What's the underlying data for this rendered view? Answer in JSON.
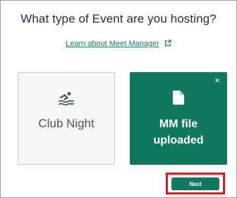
{
  "dialog": {
    "title": "What type of Event are you hosting?",
    "learn_link": "Learn about Meet Manager",
    "link_icon": "external-link-icon"
  },
  "cards": {
    "club_night": {
      "label": "Club Night",
      "icon": "swimmer-icon",
      "selected": false
    },
    "mm_file": {
      "label_line1": "MM file",
      "label_line2": "uploaded",
      "icon": "document-icon",
      "close": "×",
      "selected": true
    }
  },
  "actions": {
    "next_label": "Next"
  },
  "colors": {
    "accent": "#10785f",
    "link": "#137a65",
    "title": "#1f2a44",
    "highlight": "#e4141b"
  }
}
